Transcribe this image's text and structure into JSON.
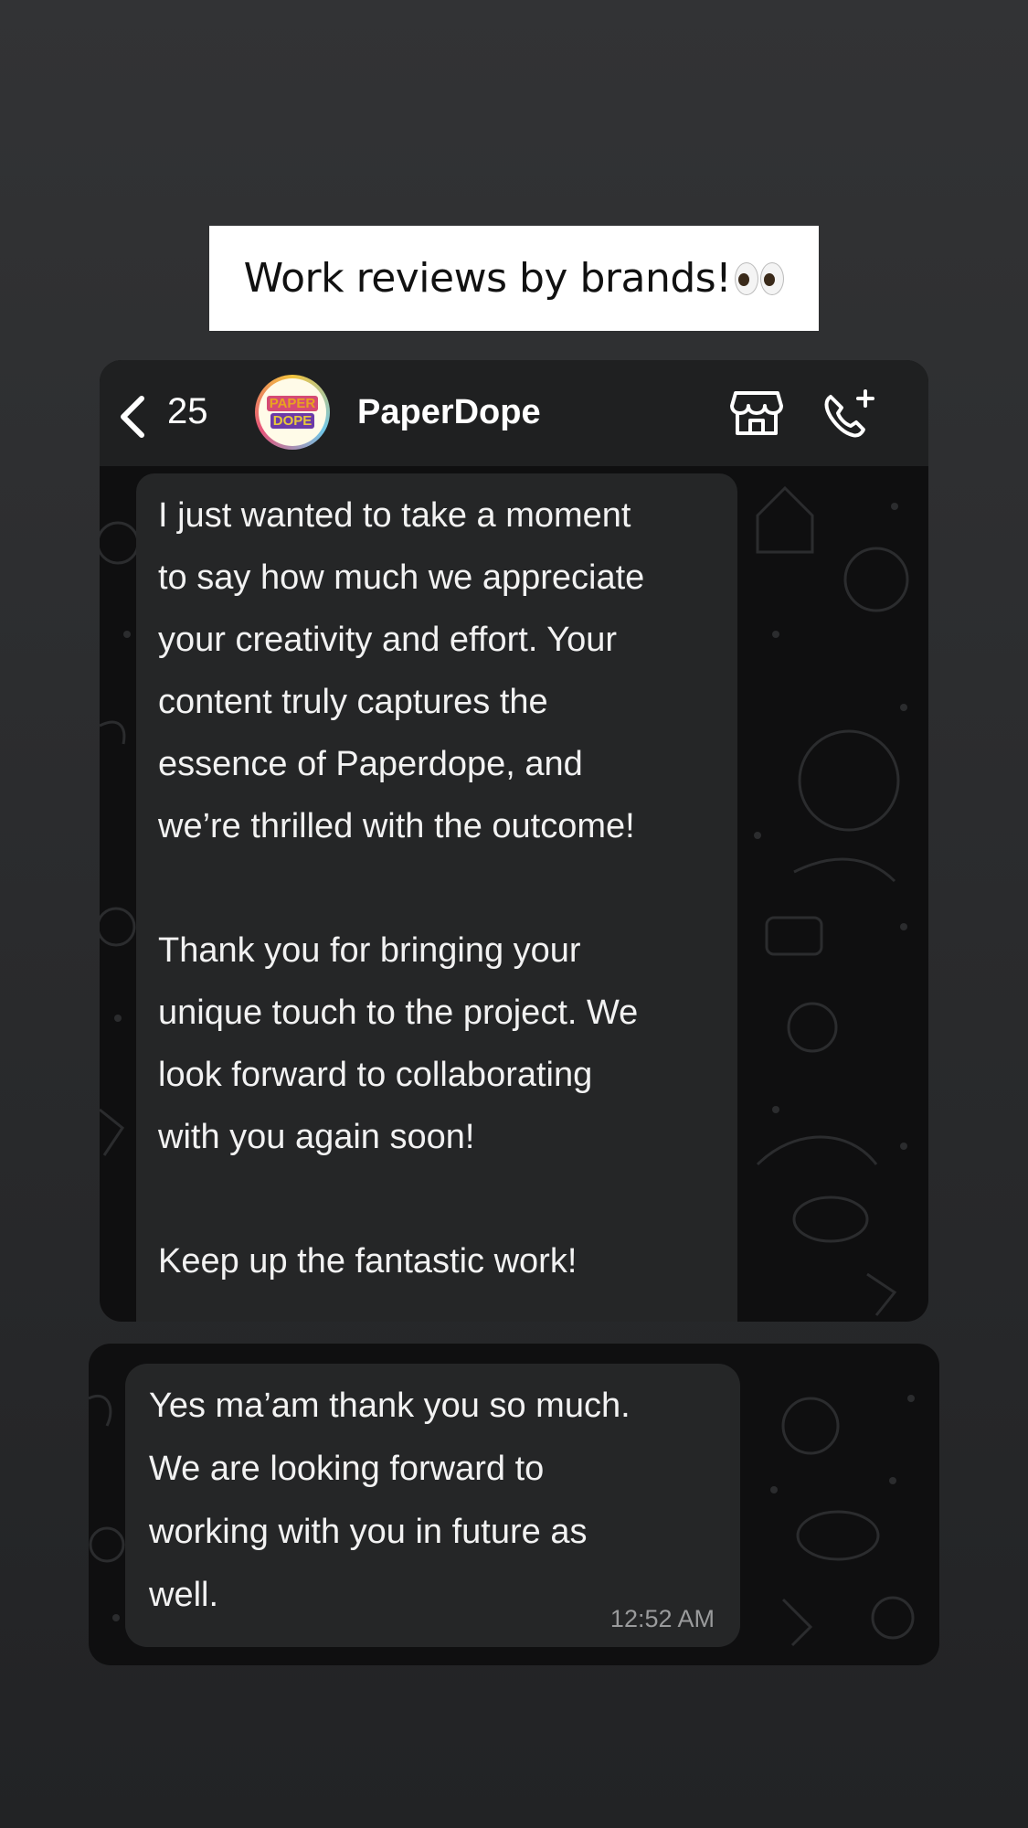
{
  "title_card": {
    "text": "Work reviews by brands!"
  },
  "header": {
    "back_count": "25",
    "contact_name": "PaperDope",
    "avatar_line1": "PAPER",
    "avatar_line2": "DOPE"
  },
  "messages": [
    {
      "text": "I just wanted to take a moment\nto say how much we appreciate\nyour creativity and effort. Your\ncontent truly captures the\nessence of Paperdope, and\nwe’re thrilled with the outcome!\n\nThank you for bringing your\nunique touch to the project. We\nlook forward to collaborating\nwith you again soon!\n\nKeep up the fantastic work!"
    },
    {
      "text": "Yes ma’am thank you so much.\nWe are looking forward to\nworking with you in future as\nwell.",
      "time": "12:52 AM"
    }
  ],
  "colors": {
    "page_bg": "#2a2b2d",
    "bubble": "#252627",
    "chat_bg": "#0f0f10",
    "header_bg": "#1f2021",
    "timestamp": "#9a9b9c"
  },
  "icons": [
    "chevron-left-icon",
    "store-icon",
    "call-add-icon",
    "eyes-emoji-icon"
  ]
}
